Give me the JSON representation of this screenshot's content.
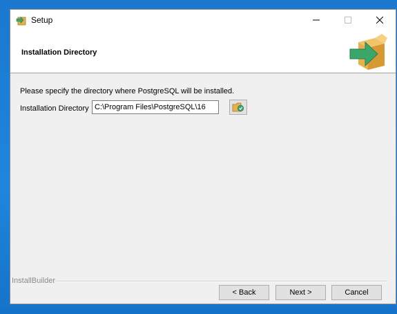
{
  "window": {
    "title": "Setup",
    "controls": {
      "minimize": "—",
      "maximize": "☐",
      "close": "✕"
    }
  },
  "header": {
    "title": "Installation Directory",
    "logo_icon": "installer-box-arrow-icon"
  },
  "body": {
    "instruction": "Please specify the directory where PostgreSQL will be installed.",
    "directory_label": "Installation Directory",
    "directory_value": "C:\\Program Files\\PostgreSQL\\16",
    "browse_icon": "folder-browse-icon"
  },
  "footer": {
    "brand": "InstallBuilder",
    "back_label": "< Back",
    "next_label": "Next >",
    "cancel_label": "Cancel"
  },
  "colors": {
    "desktop": "#1a78d0",
    "window_bg": "#f0f0f0",
    "header_bg": "#ffffff",
    "logo_box": "#e8b04a",
    "logo_arrow": "#3aa66a"
  }
}
